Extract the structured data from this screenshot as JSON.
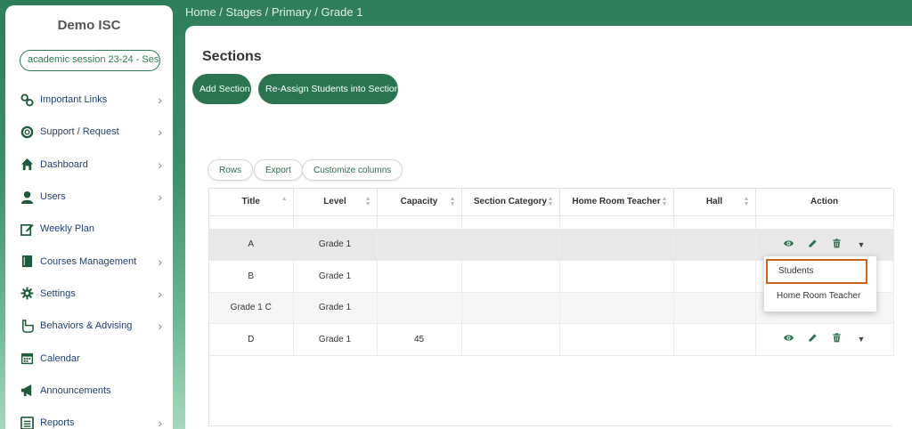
{
  "sidebar": {
    "school_name": "Demo ISC",
    "session": "academic session 23-24 - Ses...",
    "items": [
      {
        "label": "Important Links",
        "icon": "link-icon",
        "has_chevron": true
      },
      {
        "label": "Support / Request",
        "icon": "lifebuoy-icon",
        "has_chevron": true
      },
      {
        "label": "Dashboard",
        "icon": "home-icon",
        "has_chevron": true
      },
      {
        "label": "Users",
        "icon": "user-icon",
        "has_chevron": true
      },
      {
        "label": "Weekly Plan",
        "icon": "edit-icon",
        "has_chevron": false
      },
      {
        "label": "Courses Management",
        "icon": "book-icon",
        "has_chevron": true
      },
      {
        "label": "Settings",
        "icon": "gear-icon",
        "has_chevron": true
      },
      {
        "label": "Behaviors & Advising",
        "icon": "hand-icon",
        "has_chevron": true
      },
      {
        "label": "Calendar",
        "icon": "calendar-icon",
        "has_chevron": false
      },
      {
        "label": "Announcements",
        "icon": "megaphone-icon",
        "has_chevron": false
      },
      {
        "label": "Reports",
        "icon": "report-icon",
        "has_chevron": true
      }
    ]
  },
  "breadcrumb": [
    "Home",
    "Stages",
    "Primary",
    "Grade 1"
  ],
  "breadcrumb_sep": " / ",
  "page_title": "Sections",
  "buttons": {
    "add_section": "Add Section",
    "reassign": "Re-Assign Students into Sections",
    "rows": "Rows",
    "export": "Export",
    "customize": "Customize columns"
  },
  "table": {
    "columns": [
      "Title",
      "Level",
      "Capacity",
      "Section Category",
      "Home Room Teacher",
      "Hall",
      "Action"
    ],
    "rows": [
      {
        "title": "A",
        "level": "Grade 1",
        "capacity": "",
        "category": "",
        "teacher": "",
        "hall": "",
        "actions": true
      },
      {
        "title": "B",
        "level": "Grade 1",
        "capacity": "",
        "category": "",
        "teacher": "",
        "hall": "",
        "actions": false
      },
      {
        "title": "Grade 1 C",
        "level": "Grade 1",
        "capacity": "",
        "category": "",
        "teacher": "",
        "hall": "",
        "actions": false
      },
      {
        "title": "D",
        "level": "Grade 1",
        "capacity": "45",
        "category": "",
        "teacher": "",
        "hall": "",
        "actions": true
      }
    ]
  },
  "dropdown": {
    "items": [
      "Students",
      "Home Room Teacher"
    ]
  },
  "colors": {
    "brand_green": "#2a7450",
    "highlight_border": "#d4611b",
    "nav_text": "#1f3f6e"
  }
}
